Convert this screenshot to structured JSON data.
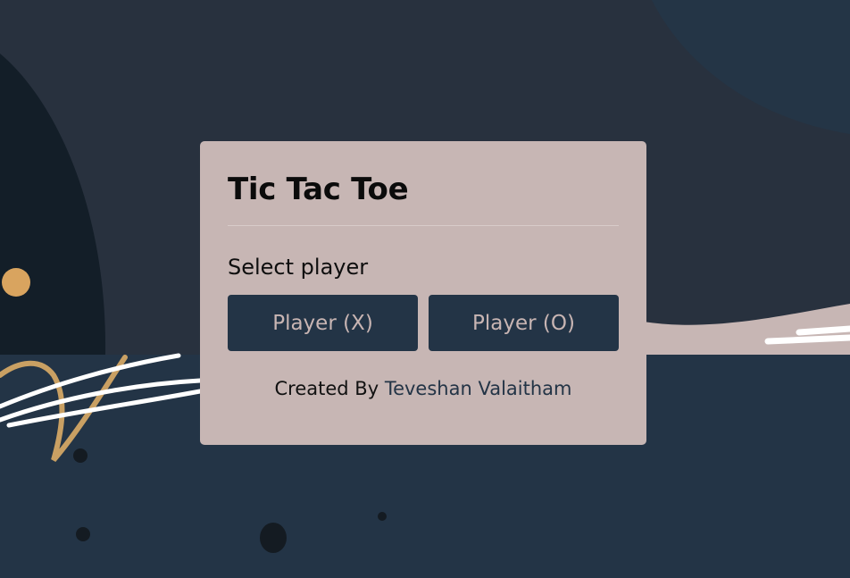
{
  "game": {
    "title": "Tic Tac Toe",
    "prompt": "Select player",
    "player_x_label": "Player (X)",
    "player_o_label": "Player (O)",
    "credit_prefix": "Created By",
    "credit_author": "Teveshan Valaitham"
  },
  "colors": {
    "background": "#233446",
    "modal": "#c7b6b4",
    "button": "#233446",
    "button_text": "#c8b5b3",
    "accent_gold": "#c9a063",
    "dark_shape": "#131e28"
  },
  "icons": [
    "gold-dot-decoration",
    "scribble-decoration"
  ]
}
